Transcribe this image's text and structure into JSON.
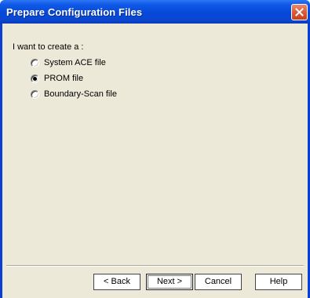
{
  "window": {
    "title": "Prepare Configuration Files"
  },
  "content": {
    "prompt": "I want to create a :",
    "options": [
      {
        "label": "System ACE file",
        "selected": false
      },
      {
        "label": "PROM file",
        "selected": true
      },
      {
        "label": "Boundary-Scan file",
        "selected": false
      }
    ]
  },
  "buttons": {
    "back": "< Back",
    "next": "Next >",
    "cancel": "Cancel",
    "help": "Help"
  },
  "colors": {
    "titlebar": "#0549d8",
    "client_bg": "#ece9d8",
    "close_button": "#dd5f3c"
  }
}
